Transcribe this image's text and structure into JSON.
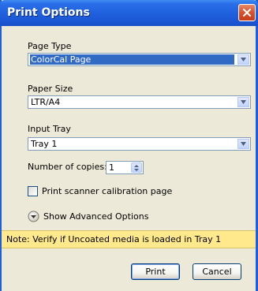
{
  "window": {
    "title": "Print Options"
  },
  "fields": {
    "page_type": {
      "label": "Page Type",
      "value": "ColorCal Page"
    },
    "paper_size": {
      "label": "Paper Size",
      "value": "LTR/A4"
    },
    "input_tray": {
      "label": "Input Tray",
      "value": "Tray 1"
    }
  },
  "copies": {
    "label": "Number of copies:",
    "value": "1"
  },
  "calibration": {
    "label": "Print scanner calibration page",
    "checked": false
  },
  "advanced": {
    "label": "Show Advanced Options"
  },
  "note": "Note: Verify if Uncoated media is loaded in Tray 1",
  "buttons": {
    "print": "Print",
    "cancel": "Cancel"
  },
  "colors": {
    "title_bar": "#1f5fdc",
    "close_button": "#d9542f",
    "selection": "#316ac5",
    "note_background": "#ffe98c",
    "dialog_background": "#ece9d8"
  },
  "icons": {
    "close": "close-icon",
    "dropdown": "chevron-down-icon",
    "spinner": "spinner-arrows-icon",
    "advanced": "expand-circle-icon"
  }
}
